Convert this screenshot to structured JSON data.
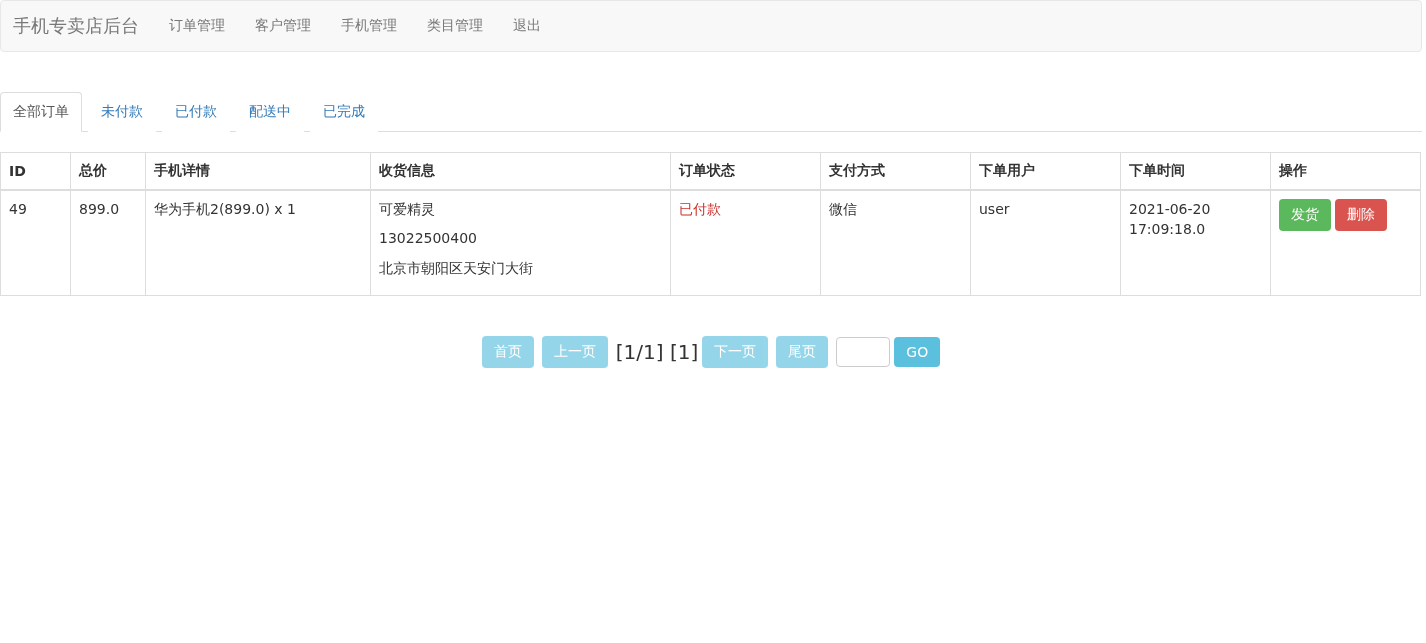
{
  "navbar": {
    "brand": "手机专卖店后台",
    "links": [
      "订单管理",
      "客户管理",
      "手机管理",
      "类目管理",
      "退出"
    ]
  },
  "tabs": [
    {
      "label": "全部订单",
      "selected": true
    },
    {
      "label": "未付款",
      "selected": false
    },
    {
      "label": "已付款",
      "selected": false
    },
    {
      "label": "配送中",
      "selected": false
    },
    {
      "label": "已完成",
      "selected": false
    }
  ],
  "table": {
    "columns": [
      "ID",
      "总价",
      "手机详情",
      "收货信息",
      "订单状态",
      "支付方式",
      "下单用户",
      "下单时间",
      "操作"
    ],
    "rows": [
      {
        "id": "49",
        "total": "899.0",
        "detail": "华为手机2(899.0) x 1",
        "receiver": [
          "可爱精灵",
          "13022500400",
          "北京市朝阳区天安门大街"
        ],
        "status": "已付款",
        "payment": "微信",
        "user": "user",
        "time": "2021-06-20 17:09:18.0",
        "actions": [
          {
            "label": "发货",
            "kind": "success"
          },
          {
            "label": "删除",
            "kind": "danger"
          }
        ]
      }
    ]
  },
  "pagination": {
    "buttons": [
      {
        "label": "首页",
        "disabled": true
      },
      {
        "label": "上一页",
        "disabled": true
      }
    ],
    "info": "[1/1] [1]",
    "next_buttons": [
      {
        "label": "下一页",
        "disabled": true
      },
      {
        "label": "尾页",
        "disabled": true
      }
    ],
    "go": "GO"
  }
}
